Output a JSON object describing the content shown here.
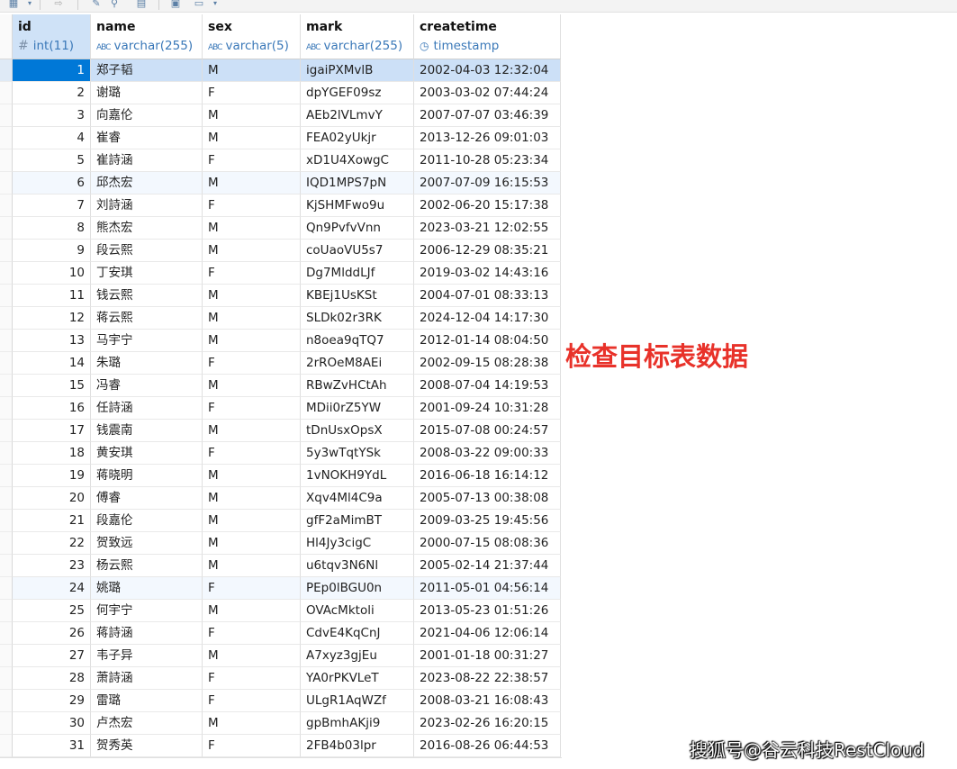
{
  "toolbar": {
    "icons": [
      "table-icon",
      "dropdown-icon",
      "export-icon",
      "edit-icon",
      "filter-icon",
      "grid-icon",
      "chart-icon",
      "dropdown-icon"
    ]
  },
  "columns": [
    {
      "name": "id",
      "type": "int(11)",
      "icon": "#"
    },
    {
      "name": "name",
      "type": "varchar(255)",
      "icon": "ABC"
    },
    {
      "name": "sex",
      "type": "varchar(5)",
      "icon": "ABC"
    },
    {
      "name": "mark",
      "type": "varchar(255)",
      "icon": "ABC"
    },
    {
      "name": "createtime",
      "type": "timestamp",
      "icon": "◷"
    }
  ],
  "rows": [
    [
      "1",
      "郑子韬",
      "M",
      "igaiPXMvlB",
      "2002-04-03 12:32:04"
    ],
    [
      "2",
      "谢璐",
      "F",
      "dpYGEF09sz",
      "2003-03-02 07:44:24"
    ],
    [
      "3",
      "向嘉伦",
      "M",
      "AEb2lVLmvY",
      "2007-07-07 03:46:39"
    ],
    [
      "4",
      "崔睿",
      "M",
      "FEA02yUkjr",
      "2013-12-26 09:01:03"
    ],
    [
      "5",
      "崔詩涵",
      "F",
      "xD1U4XowgC",
      "2011-10-28 05:23:34"
    ],
    [
      "6",
      "邱杰宏",
      "M",
      "IQD1MPS7pN",
      "2007-07-09 16:15:53"
    ],
    [
      "7",
      "刘詩涵",
      "F",
      "KjSHMFwo9u",
      "2002-06-20 15:17:38"
    ],
    [
      "8",
      "熊杰宏",
      "M",
      "Qn9PvfvVnn",
      "2023-03-21 12:02:55"
    ],
    [
      "9",
      "段云熙",
      "M",
      "coUaoVU5s7",
      "2006-12-29 08:35:21"
    ],
    [
      "10",
      "丁安琪",
      "F",
      "Dg7MlddLJf",
      "2019-03-02 14:43:16"
    ],
    [
      "11",
      "钱云熙",
      "M",
      "KBEj1UsKSt",
      "2004-07-01 08:33:13"
    ],
    [
      "12",
      "蒋云熙",
      "M",
      "SLDk02r3RK",
      "2024-12-04 14:17:30"
    ],
    [
      "13",
      "马宇宁",
      "M",
      "n8oea9qTQ7",
      "2012-01-14 08:04:50"
    ],
    [
      "14",
      "朱璐",
      "F",
      "2rROeM8AEi",
      "2002-09-15 08:28:38"
    ],
    [
      "15",
      "冯睿",
      "M",
      "RBwZvHCtAh",
      "2008-07-04 14:19:53"
    ],
    [
      "16",
      "任詩涵",
      "F",
      "MDii0rZ5YW",
      "2001-09-24 10:31:28"
    ],
    [
      "17",
      "钱震南",
      "M",
      "tDnUsxOpsX",
      "2015-07-08 00:24:57"
    ],
    [
      "18",
      "黄安琪",
      "F",
      "5y3wTqtYSk",
      "2008-03-22 09:00:33"
    ],
    [
      "19",
      "蒋晓明",
      "M",
      "1vNOKH9YdL",
      "2016-06-18 16:14:12"
    ],
    [
      "20",
      "傅睿",
      "M",
      "Xqv4Ml4C9a",
      "2005-07-13 00:38:08"
    ],
    [
      "21",
      "段嘉伦",
      "M",
      "gfF2aMimBT",
      "2009-03-25 19:45:56"
    ],
    [
      "22",
      "贺致远",
      "M",
      "Hl4Jy3cigC",
      "2000-07-15 08:08:36"
    ],
    [
      "23",
      "杨云熙",
      "M",
      "u6tqv3N6Nl",
      "2005-02-14 21:37:44"
    ],
    [
      "24",
      "姚璐",
      "F",
      "PEp0lBGU0n",
      "2011-05-01 04:56:14"
    ],
    [
      "25",
      "何宇宁",
      "M",
      "OVAcMktoli",
      "2013-05-23 01:51:26"
    ],
    [
      "26",
      "蒋詩涵",
      "F",
      "CdvE4KqCnJ",
      "2021-04-06 12:06:14"
    ],
    [
      "27",
      "韦子异",
      "M",
      "A7xyz3gjEu",
      "2001-01-18 00:31:27"
    ],
    [
      "28",
      "萧詩涵",
      "F",
      "YA0rPKVLeT",
      "2023-08-22 22:38:57"
    ],
    [
      "29",
      "雷璐",
      "F",
      "ULgR1AqWZf",
      "2008-03-21 16:08:43"
    ],
    [
      "30",
      "卢杰宏",
      "M",
      "gpBmhAKji9",
      "2023-02-26 16:20:15"
    ],
    [
      "31",
      "贺秀英",
      "F",
      "2FB4b03lpr",
      "2016-08-26 06:44:53"
    ]
  ],
  "selected_row": 0,
  "annotation": "检查目标表数据",
  "watermark": "搜狐号@谷云科技RestCloud",
  "colors": {
    "selected_id_bg": "#0078d7",
    "selected_row_bg": "#cce0f7",
    "type_text": "#3a78b8",
    "annotation": "#e8322a"
  }
}
